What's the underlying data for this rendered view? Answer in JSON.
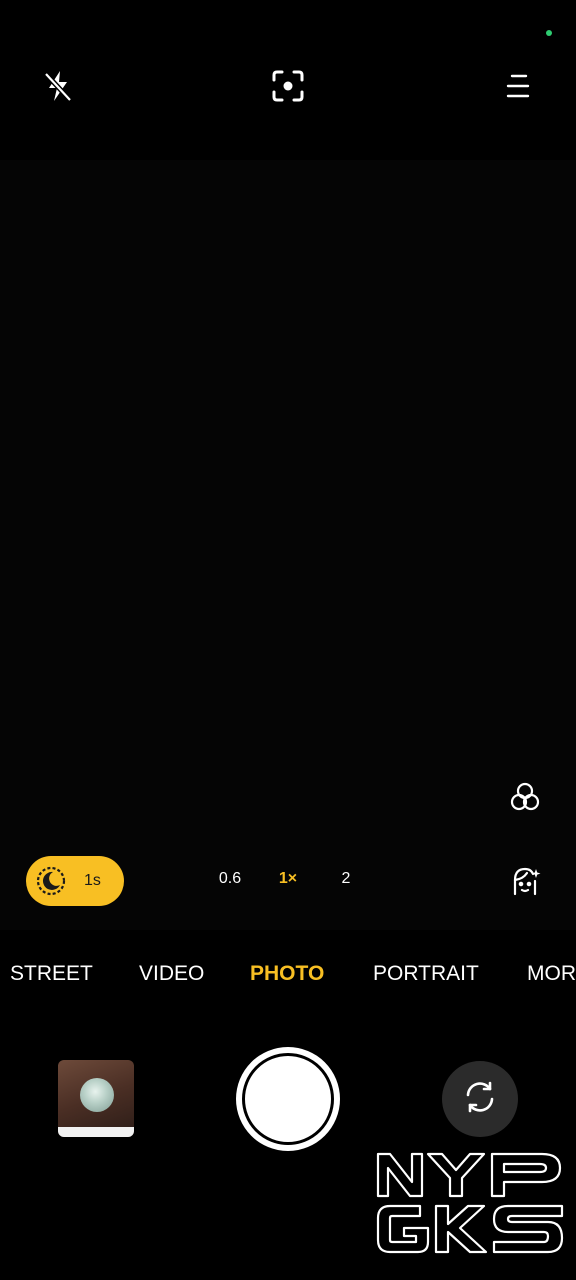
{
  "status": {
    "indicator_color": "#2ecc71"
  },
  "topbar": {
    "icons": [
      "flash-off-icon",
      "google-lens-icon",
      "menu-icon"
    ]
  },
  "controls": {
    "filter_icon": "filters-icon",
    "beauty_icon": "beauty-face-icon",
    "night_mode": {
      "icon": "night-mode-icon",
      "value": "1s",
      "color": "#f8bf23"
    },
    "zoom_levels": [
      {
        "label": "0.6",
        "active": false
      },
      {
        "label": "1×",
        "active": true
      },
      {
        "label": "2",
        "active": false
      }
    ]
  },
  "modes": [
    {
      "label": "STREET",
      "active": false
    },
    {
      "label": "VIDEO",
      "active": false
    },
    {
      "label": "PHOTO",
      "active": true
    },
    {
      "label": "PORTRAIT",
      "active": false
    },
    {
      "label": "MOR",
      "active": false
    }
  ],
  "bottom": {
    "gallery_thumbnail": "last-photo-thumbnail",
    "shutter": "shutter-button",
    "switch_camera_icon": "switch-camera-icon"
  },
  "watermark": {
    "line1": "NYP",
    "line2": "GKS"
  },
  "accent_color": "#f8bf23"
}
